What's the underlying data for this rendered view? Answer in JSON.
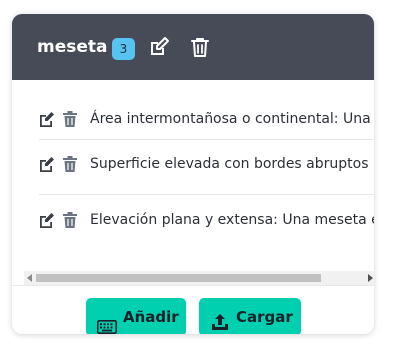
{
  "colors": {
    "header_bg": "#464b57",
    "badge_bg": "#56c3f2",
    "button_bg": "#00cfb0",
    "row_icon": "#3a3f47"
  },
  "header": {
    "title": "meseta",
    "badge_count": "3",
    "edit_icon": "edit-icon",
    "delete_icon": "trash-icon"
  },
  "items": [
    {
      "text": "Área intermontañosa o continental: Una meseta es un área elevada"
    },
    {
      "text": "Superficie elevada con bordes abruptos"
    },
    {
      "text": "Elevación plana y extensa: Una meseta es una elevación"
    }
  ],
  "footer": {
    "add_label": "Añadir",
    "add_icon": "keyboard-icon",
    "upload_label": "Cargar",
    "upload_icon": "upload-icon"
  }
}
